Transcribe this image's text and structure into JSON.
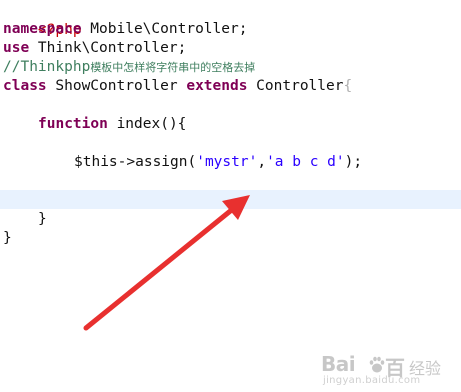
{
  "editor": {
    "lines": {
      "php_open": "<?php",
      "namespace_kw": "namespace",
      "namespace_name": " Mobile\\Controller;",
      "use_kw": "use",
      "use_name": " Think\\Controller;",
      "comment_prefix": "//Thinkphp",
      "comment_cjk": "模板中怎样将字符串中的空格去掉",
      "class_kw": "class",
      "class_name": " ShowController ",
      "extends_kw": "extends",
      "parent_name": " Controller",
      "class_brace": "{",
      "function_kw": "function",
      "function_sig": " index(){",
      "assign_prefix": "$this->assign(",
      "assign_key": "'mystr'",
      "assign_comma": ",",
      "assign_value": "'a b c d'",
      "assign_suffix": ");",
      "close_function": "}",
      "close_class": "}"
    }
  },
  "colors": {
    "keyword": "#7f0055",
    "php_tag": "#c80000",
    "string": "#2a00ff",
    "comment": "#3f7f5f",
    "current_line": "#e8f2fe",
    "arrow": "#e8302f"
  },
  "overlay": {
    "arrow_icon": "red-annotation-arrow"
  },
  "watermark": {
    "logo_left": "Bai",
    "logo_right": "百",
    "section": "经验",
    "url": "jingyan.baidu.com"
  }
}
